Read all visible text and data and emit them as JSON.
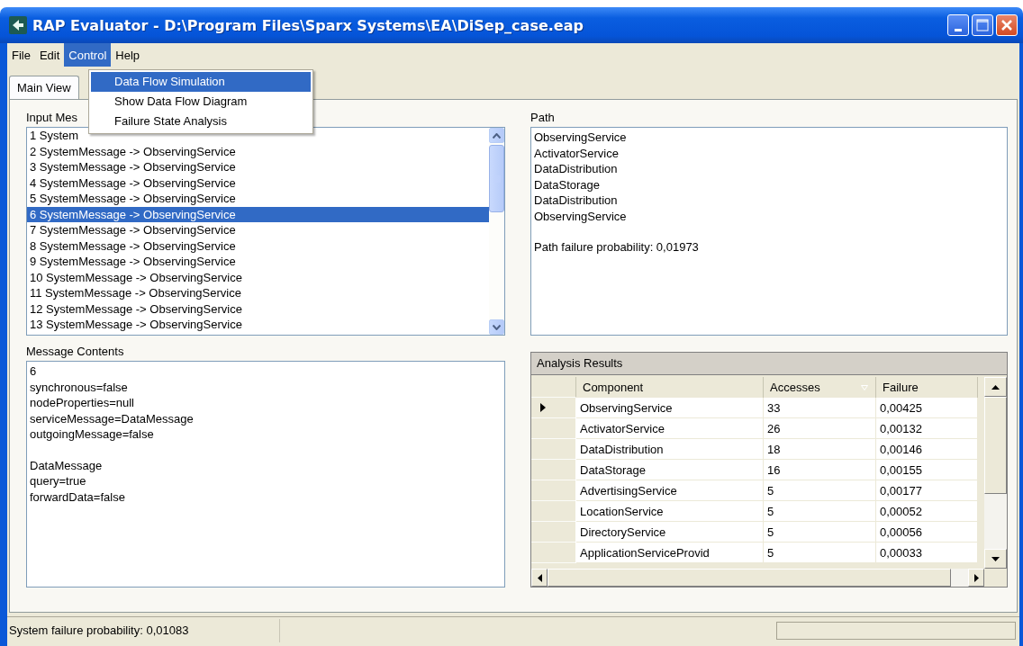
{
  "window": {
    "title": "RAP Evaluator - D:\\Program Files\\Sparx Systems\\EA\\DiSep_case.eap"
  },
  "menu_bar": [
    {
      "label": "File",
      "selected": false
    },
    {
      "label": "Edit",
      "selected": false
    },
    {
      "label": "Control",
      "selected": true
    },
    {
      "label": "Help",
      "selected": false
    }
  ],
  "dropdown_menu": [
    {
      "label": "Data Flow Simulation",
      "selected": true
    },
    {
      "label": "Show Data Flow Diagram",
      "selected": false
    },
    {
      "label": "Failure State Analysis",
      "selected": false
    }
  ],
  "tabs": [
    {
      "label": "Main View",
      "selected": true
    }
  ],
  "input_messages": {
    "label": "Input Mes",
    "items": [
      {
        "text": "1 System",
        "selected": false
      },
      {
        "text": "2 SystemMessage -> ObservingService",
        "selected": false
      },
      {
        "text": "3 SystemMessage -> ObservingService",
        "selected": false
      },
      {
        "text": "4 SystemMessage -> ObservingService",
        "selected": false
      },
      {
        "text": "5 SystemMessage -> ObservingService",
        "selected": false
      },
      {
        "text": "6 SystemMessage -> ObservingService",
        "selected": true
      },
      {
        "text": "7 SystemMessage -> ObservingService",
        "selected": false
      },
      {
        "text": "8 SystemMessage -> ObservingService",
        "selected": false
      },
      {
        "text": "9 SystemMessage -> ObservingService",
        "selected": false
      },
      {
        "text": "10 SystemMessage -> ObservingService",
        "selected": false
      },
      {
        "text": "11 SystemMessage -> ObservingService",
        "selected": false
      },
      {
        "text": "12 SystemMessage -> ObservingService",
        "selected": false
      },
      {
        "text": "13 SystemMessage -> ObservingService",
        "selected": false
      }
    ]
  },
  "path": {
    "label": "Path",
    "lines": [
      "ObservingService",
      "ActivatorService",
      "DataDistribution",
      "DataStorage",
      "DataDistribution",
      "ObservingService"
    ],
    "summary": "Path failure probability: 0,01973"
  },
  "message_contents": {
    "label": "Message Contents",
    "paragraphs": [
      [
        "6",
        "synchronous=false",
        "nodeProperties=null",
        "serviceMessage=DataMessage",
        "outgoingMessage=false"
      ],
      [
        "DataMessage",
        "query=true",
        "forwardData=false"
      ]
    ]
  },
  "analysis_results": {
    "title": "Analysis Results",
    "columns": [
      {
        "label": "Component",
        "sorted": false
      },
      {
        "label": "Accesses",
        "sorted": true
      },
      {
        "label": "Failure",
        "sorted": false
      }
    ],
    "rows": [
      {
        "cells": [
          "ObservingService",
          "33",
          "0,00425"
        ],
        "current": true
      },
      {
        "cells": [
          "ActivatorService",
          "26",
          "0,00132"
        ],
        "current": false
      },
      {
        "cells": [
          "DataDistribution",
          "18",
          "0,00146"
        ],
        "current": false
      },
      {
        "cells": [
          "DataStorage",
          "16",
          "0,00155"
        ],
        "current": false
      },
      {
        "cells": [
          "AdvertisingService",
          "5",
          "0,00177"
        ],
        "current": false
      },
      {
        "cells": [
          "LocationService",
          "5",
          "0,00052"
        ],
        "current": false
      },
      {
        "cells": [
          "DirectoryService",
          "5",
          "0,00056"
        ],
        "current": false
      },
      {
        "cells": [
          "ApplicationServiceProvid",
          "5",
          "0,00033"
        ],
        "current": false
      }
    ]
  },
  "status_bar": {
    "text": "System failure probability: 0,01083"
  }
}
